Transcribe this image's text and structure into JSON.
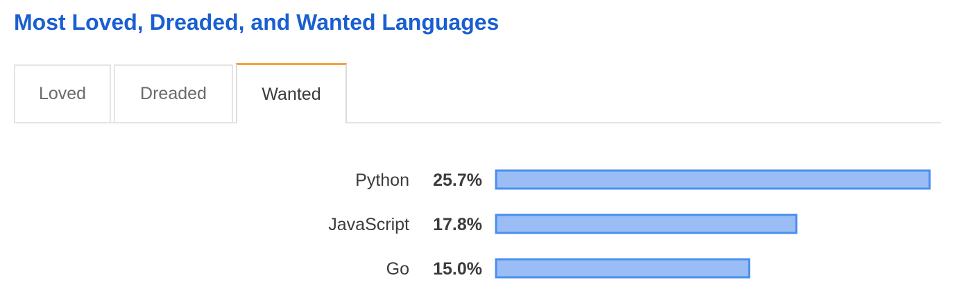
{
  "page": {
    "title": "Most Loved, Dreaded, and Wanted Languages"
  },
  "tabs": [
    {
      "label": "Loved",
      "active": false
    },
    {
      "label": "Dreaded",
      "active": false
    },
    {
      "label": "Wanted",
      "active": true
    }
  ],
  "colors": {
    "title": "#1a5fd1",
    "active_tab_accent": "#f4a13a",
    "bar_fill": "#99bdf4",
    "bar_stroke": "#4b8ff0",
    "label_text": "#3b3b3b"
  },
  "chart_data": {
    "type": "bar",
    "orientation": "horizontal",
    "categories": [
      "Python",
      "JavaScript",
      "Go"
    ],
    "values": [
      25.7,
      17.8,
      15.0
    ],
    "value_labels": [
      "25.7%",
      "17.8%",
      "15.0%"
    ],
    "unit": "%",
    "xlim": [
      0,
      25.7
    ]
  }
}
